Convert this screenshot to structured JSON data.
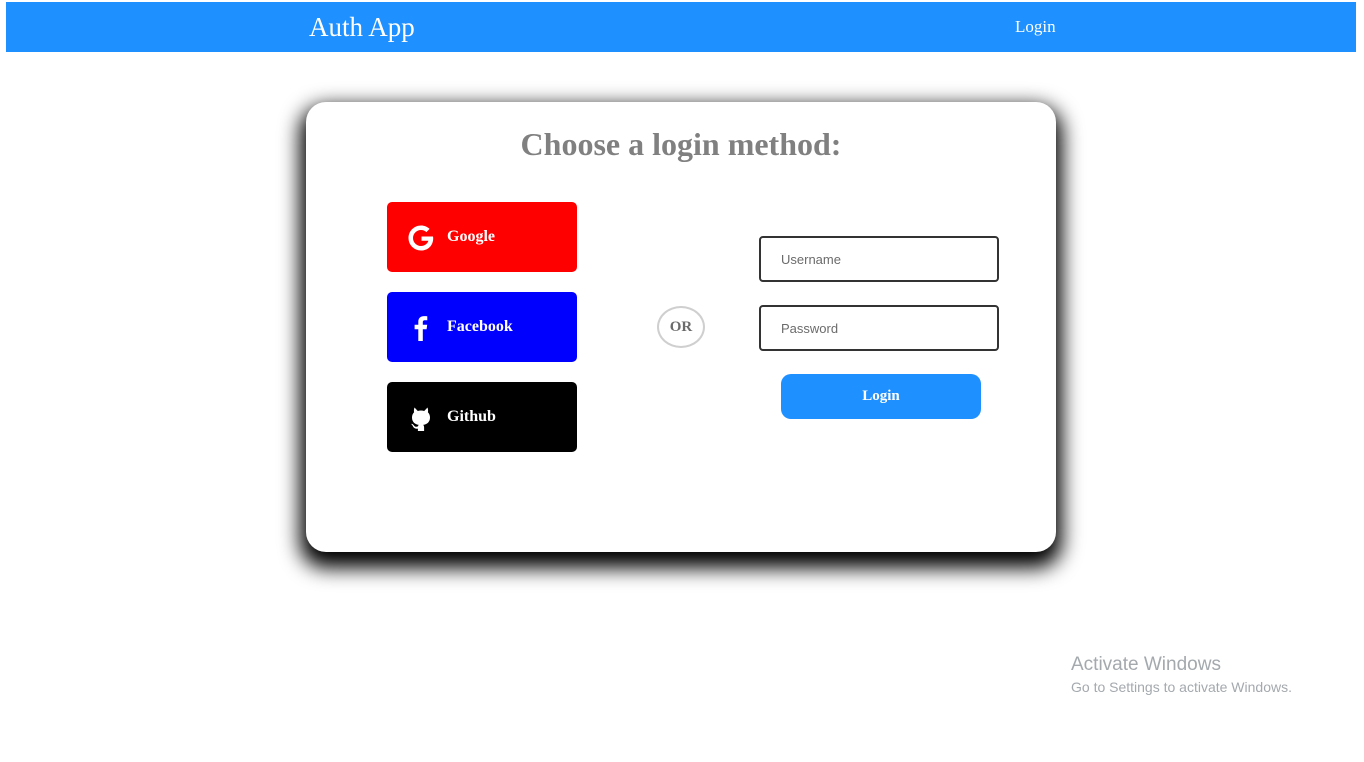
{
  "navbar": {
    "brand": "Auth App",
    "login_link": "Login",
    "color": "#1e90ff"
  },
  "card": {
    "title": "Choose a login method:",
    "social": [
      {
        "label": "Google",
        "icon": "google-icon",
        "color": "#ff0000"
      },
      {
        "label": "Facebook",
        "icon": "facebook-icon",
        "color": "#0000ff"
      },
      {
        "label": "Github",
        "icon": "github-icon",
        "color": "#000000"
      }
    ],
    "divider": "OR",
    "form": {
      "username_placeholder": "Username",
      "username_value": "",
      "password_placeholder": "Password",
      "password_value": "",
      "submit_label": "Login"
    }
  },
  "watermark": {
    "title": "Activate Windows",
    "subtitle": "Go to Settings to activate Windows."
  }
}
